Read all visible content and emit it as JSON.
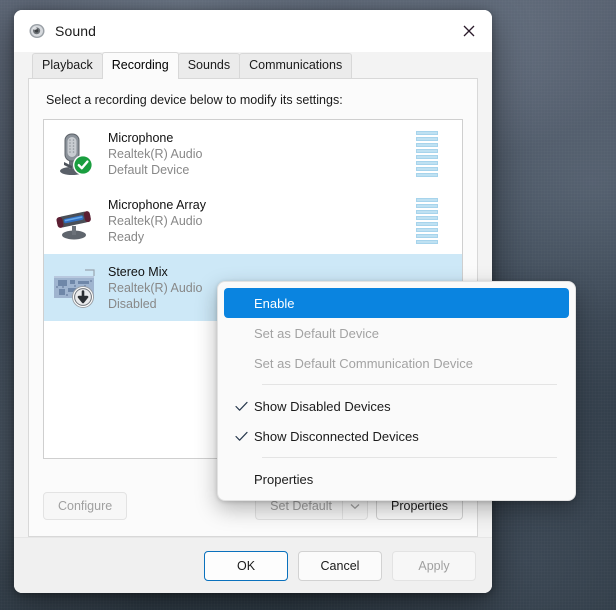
{
  "window": {
    "title": "Sound",
    "title_icon": "speaker-icon",
    "close_icon": "close-icon"
  },
  "tabs": [
    {
      "label": "Playback",
      "active": false
    },
    {
      "label": "Recording",
      "active": true
    },
    {
      "label": "Sounds",
      "active": false
    },
    {
      "label": "Communications",
      "active": false
    }
  ],
  "panel": {
    "hint": "Select a recording device below to modify its settings:"
  },
  "devices": [
    {
      "name": "Microphone",
      "driver": "Realtek(R) Audio",
      "status": "Default Device",
      "icon": "microphone-icon",
      "badge": "default-check-badge",
      "selected": false,
      "meter_segments": 8
    },
    {
      "name": "Microphone Array",
      "driver": "Realtek(R) Audio",
      "status": "Ready",
      "icon": "microphone-array-icon",
      "badge": "none",
      "selected": false,
      "meter_segments": 8
    },
    {
      "name": "Stereo Mix",
      "driver": "Realtek(R) Audio",
      "status": "Disabled",
      "icon": "sound-card-icon",
      "badge": "disabled-arrow-badge",
      "selected": true,
      "meter_segments": 0
    }
  ],
  "actions": {
    "configure": {
      "label": "Configure",
      "disabled": true
    },
    "set_default": {
      "label": "Set Default",
      "disabled": true,
      "arrow_icon": "chevron-down-icon"
    },
    "properties": {
      "label": "Properties",
      "disabled": false
    }
  },
  "footer": {
    "ok": {
      "label": "OK",
      "default": true
    },
    "cancel": {
      "label": "Cancel"
    },
    "apply": {
      "label": "Apply",
      "disabled": true
    }
  },
  "context_menu": {
    "items": [
      {
        "label": "Enable",
        "state": "highlight",
        "checked": false
      },
      {
        "label": "Set as Default Device",
        "state": "disabled",
        "checked": false
      },
      {
        "label": "Set as Default Communication Device",
        "state": "disabled",
        "checked": false
      },
      {
        "separator": true
      },
      {
        "label": "Show Disabled Devices",
        "state": "normal",
        "checked": true
      },
      {
        "label": "Show Disconnected Devices",
        "state": "normal",
        "checked": true
      },
      {
        "separator": true
      },
      {
        "label": "Properties",
        "state": "normal",
        "checked": false
      }
    ]
  },
  "colors": {
    "accent": "#0a84e0",
    "selection": "#cde8f7",
    "default_badge": "#16a34a",
    "meter": "#bfe1f2"
  }
}
